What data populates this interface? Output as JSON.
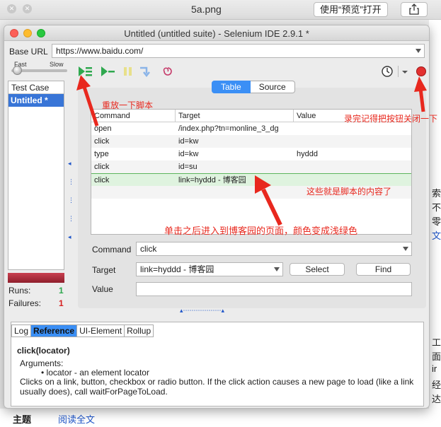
{
  "outer": {
    "title": "5a.png",
    "open_preview_button": "使用“预览”打开"
  },
  "window": {
    "title": "Untitled (untitled suite) - Selenium IDE 2.9.1 *",
    "base_url_label": "Base URL",
    "base_url_value": "https://www.baidu.com/",
    "speed_fast": "Fast",
    "speed_slow": "Slow",
    "speed_level": 0.05
  },
  "test_case_pane": {
    "header": "Test Case",
    "items": [
      "Untitled *"
    ],
    "runs_label": "Runs:",
    "runs_value": "1",
    "failures_label": "Failures:",
    "failures_value": "1"
  },
  "editor_tabs": [
    "Table",
    "Source"
  ],
  "command_table": {
    "headers": [
      "Command",
      "Target",
      "Value"
    ],
    "rows": [
      {
        "command": "open",
        "target": "/index.php?tn=monline_3_dg",
        "value": ""
      },
      {
        "command": "click",
        "target": "id=kw",
        "value": ""
      },
      {
        "command": "type",
        "target": "id=kw",
        "value": "hyddd"
      },
      {
        "command": "click",
        "target": "id=su",
        "value": ""
      },
      {
        "command": "click",
        "target": "link=hyddd - 博客园",
        "value": ""
      }
    ]
  },
  "form": {
    "command_label": "Command",
    "command_value": "click",
    "target_label": "Target",
    "target_value": "link=hyddd - 博客园",
    "select_button": "Select",
    "find_button": "Find",
    "value_label": "Value",
    "value_value": ""
  },
  "bottom_tabs": [
    "Log",
    "Reference",
    "UI-Element",
    "Rollup"
  ],
  "reference": {
    "title": "click(locator)",
    "arguments_label": "Arguments:",
    "bullet": "locator - an element locator",
    "description": "Clicks on a link, button, checkbox or radio button. If the click action causes a new page to load (like a link usually does), call waitForPageToLoad."
  },
  "annotations": {
    "replay": "重放一下脚本",
    "record_off": "录完记得把按钮关闭一下",
    "script_content": "这些就是脚本的内容了",
    "click_result": "单击之后进入到博客园的页面，颜色变成浅绿色"
  },
  "colors": {
    "accent": "#3b8ff5",
    "selection": "#3875d7",
    "annotation": "#e8281e",
    "row_highlight": "#dff3df"
  },
  "background_fragments": [
    "索",
    "不",
    "零",
    "文",
    "工",
    "面",
    "ir",
    "经",
    "达",
    "主题",
    "阅读全文"
  ]
}
